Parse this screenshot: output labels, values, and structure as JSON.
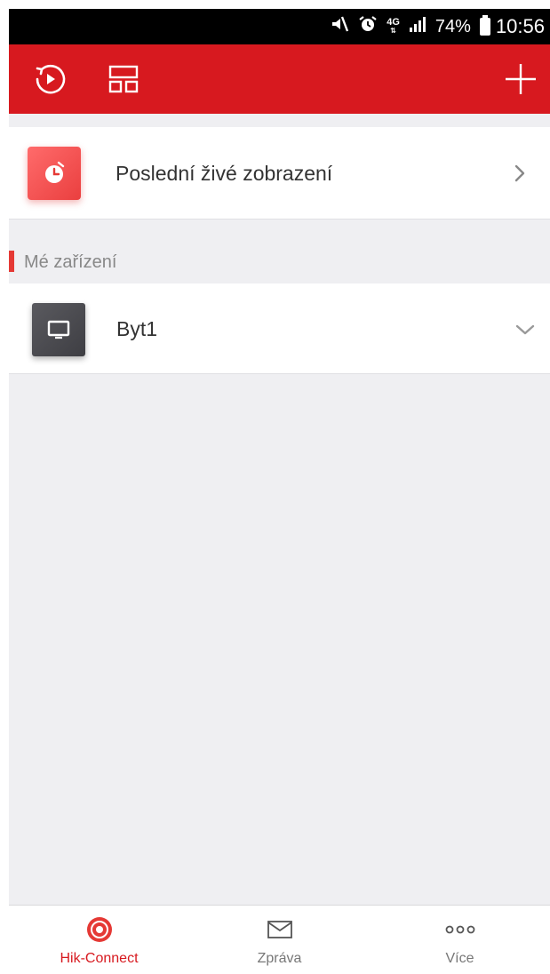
{
  "status_bar": {
    "network": "4G",
    "battery": "74%",
    "time": "10:56",
    "icons": [
      "mute-icon",
      "alarm-icon",
      "network-4g-icon",
      "signal-icon",
      "battery-icon"
    ]
  },
  "toolbar": {
    "background": "#d7191f",
    "icons": [
      "playback-icon",
      "layout-icon",
      "add-icon"
    ]
  },
  "recent": {
    "label": "Poslední živé zobrazení",
    "icon": "stopwatch-icon",
    "accent": "#ea3f3f"
  },
  "devices_section": {
    "title": "Mé zařízení",
    "items": [
      {
        "label": "Byt1",
        "icon": "monitor-icon"
      }
    ]
  },
  "bottom_nav": {
    "items": [
      {
        "label": "Hik-Connect",
        "icon": "hik-connect-icon",
        "active": true
      },
      {
        "label": "Zpráva",
        "icon": "envelope-icon",
        "active": false
      },
      {
        "label": "Více",
        "icon": "more-icon",
        "active": false
      }
    ],
    "active_color": "#d7191f"
  }
}
